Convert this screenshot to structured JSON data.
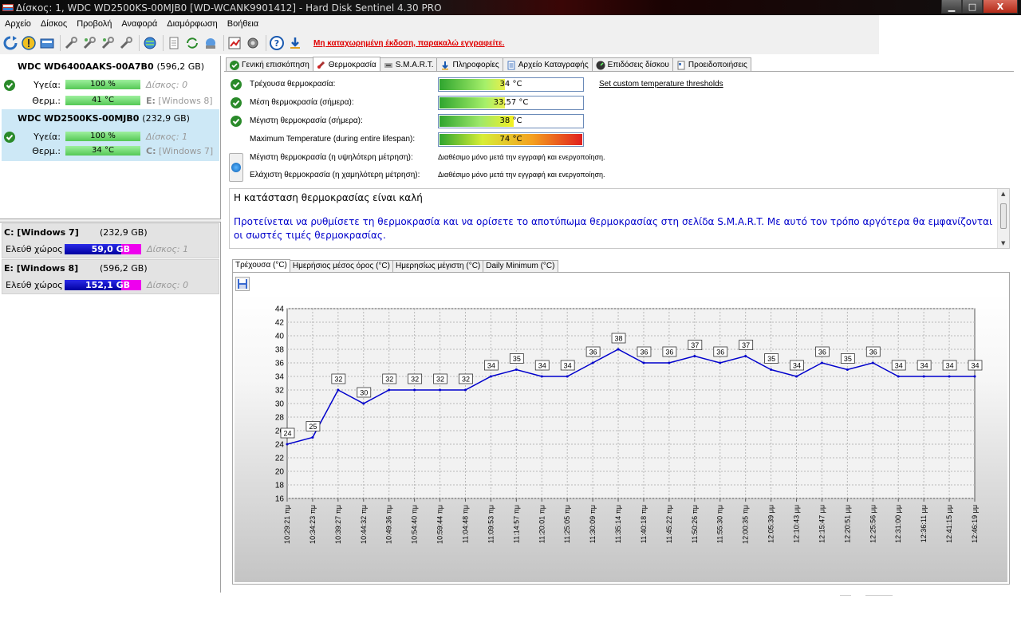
{
  "window": {
    "title": "Δίσκος: 1, WDC WD2500KS-00MJB0 [WD-WCANK9901412]  -  Hard Disk Sentinel 4.30 PRO",
    "minimize_glyph": "▁",
    "maximize_glyph": "□",
    "close_glyph": "X"
  },
  "menu": [
    "Αρχείο",
    "Δίσκος",
    "Προβολή",
    "Αναφορά",
    "Διαμόρφωση",
    "Βοήθεια"
  ],
  "toolbar": {
    "icons": [
      "refresh-icon",
      "warning-icon",
      "disk-report-icon",
      "tool1-icon",
      "tool2-icon",
      "tool3-icon",
      "tool4-icon",
      "globe-icon",
      "doc-icon",
      "sync-icon",
      "network-icon",
      "chart-icon",
      "gear-icon",
      "help-icon",
      "download-icon"
    ],
    "register_text": "Μη καταχωρημένη έκδοση, παρακαλώ εγγραφείτε."
  },
  "disks": [
    {
      "name": "WDC WD6400AAKS-00A7B0",
      "size": "(596,2 GB)",
      "health_label": "Υγεία:",
      "health": "100 %",
      "health_pct": 100,
      "disk_label": "Δίσκος: 0",
      "temp_label": "Θερμ.:",
      "temp": "41 °C",
      "volume_label": "E:",
      "volume_name": "[Windows 8]",
      "selected": false
    },
    {
      "name": "WDC WD2500KS-00MJB0",
      "size": "(232,9 GB)",
      "health_label": "Υγεία:",
      "health": "100 %",
      "health_pct": 100,
      "disk_label": "Δίσκος: 1",
      "temp_label": "Θερμ.:",
      "temp": "34 °C",
      "volume_label": "C:",
      "volume_name": "[Windows 7]",
      "selected": true
    }
  ],
  "volumes": [
    {
      "name": "C: [Windows 7]",
      "size": "(232,9 GB)",
      "free_label": "Ελεύθ χώρος",
      "free": "59,0 GB",
      "free_pct": 0.74,
      "disk": "Δίσκος: 1"
    },
    {
      "name": "E: [Windows 8]",
      "size": "(596,2 GB)",
      "free_label": "Ελεύθ χώρος",
      "free": "152,1 GB",
      "free_pct": 0.74,
      "disk": "Δίσκος: 0"
    }
  ],
  "tabs": [
    "Γενική επισκόπηση",
    "Θερμοκρασία",
    "S.M.A.R.T.",
    "Πληροφορίες",
    "Αρχείο Καταγραφής",
    "Επιδόσεις δίσκου",
    "Προειδοποιήσεις"
  ],
  "tab_icons": [
    "check-icon",
    "thermometer-icon",
    "smart-icon",
    "info-icon",
    "log-icon",
    "performance-icon",
    "alerts-icon"
  ],
  "active_tab": 1,
  "temperature": {
    "current_label": "Τρέχουσα θερμοκρασία:",
    "current": "34 °C",
    "current_fill": 0.46,
    "average_label": "Μέση θερμοκρασία (σήμερα):",
    "average": "33,57 °C",
    "average_fill": 0.46,
    "max_today_label": "Μέγιστη θερμοκρασία (σήμερα):",
    "max_today": "38 °C",
    "max_today_fill": 0.52,
    "max_life_label": "Maximum Temperature (during entire lifespan):",
    "max_life": "74 °C",
    "max_life_fill": 1.0,
    "highest_label": "Μέγιστη θερμοκρασία (η υψηλότερη μέτρηση):",
    "highest_value": "Διαθέσιμο μόνο μετά την εγγραφή και ενεργοποίηση.",
    "lowest_label": "Ελάχιστη θερμοκρασία (η χαμηλότερη μέτρηση):",
    "lowest_value": "Διαθέσιμο μόνο μετά την εγγραφή και ενεργοποίηση.",
    "custom_link": "Set custom temperature thresholds"
  },
  "status": {
    "line1": "Η κατάσταση θερμοκρασίας είναι καλή",
    "line2": "Προτείνεται να ρυθμίσετε τη θερμοκρασία και να ορίσετε το αποτύπωμα θερμοκρασίας στη σελίδα S.M.A.R.T. Με αυτό τον τρόπο αργότερα θα εμφανίζονται οι σωστές τιμές θερμοκρασίας."
  },
  "chart_tabs": [
    "Τρέχουσα (°C)",
    "Ημερήσιος μέσος όρος (°C)",
    "Ημερησίως μέγιστη (°C)",
    "Daily Minimum (°C)"
  ],
  "chart_data": {
    "type": "line",
    "x": [
      "10:29:21 πμ",
      "10:34:23 πμ",
      "10:39:27 πμ",
      "10:44:32 πμ",
      "10:49:36 πμ",
      "10:54:40 πμ",
      "10:59:44 πμ",
      "11:04:48 πμ",
      "11:09:53 πμ",
      "11:14:57 πμ",
      "11:20:01 πμ",
      "11:25:05 πμ",
      "11:30:09 πμ",
      "11:35:14 πμ",
      "11:40:18 πμ",
      "11:45:22 πμ",
      "11:50:26 πμ",
      "11:55:30 πμ",
      "12:00:35 πμ",
      "12:05:39 μμ",
      "12:10:43 μμ",
      "12:15:47 μμ",
      "12:20:51 μμ",
      "12:25:56 μμ",
      "12:31:00 μμ",
      "12:36:11 μμ",
      "12:41:15 μμ",
      "12:46:19 μμ"
    ],
    "values": [
      24,
      25,
      32,
      30,
      32,
      32,
      32,
      32,
      34,
      35,
      34,
      34,
      36,
      38,
      36,
      36,
      37,
      36,
      37,
      35,
      34,
      36,
      35,
      36,
      34,
      34,
      34,
      34
    ],
    "ylim": [
      16,
      44
    ],
    "yticks": [
      16,
      18,
      20,
      22,
      24,
      26,
      28,
      30,
      32,
      34,
      36,
      38,
      40,
      42,
      44
    ],
    "grid": true,
    "line_color": "#0000cc"
  }
}
